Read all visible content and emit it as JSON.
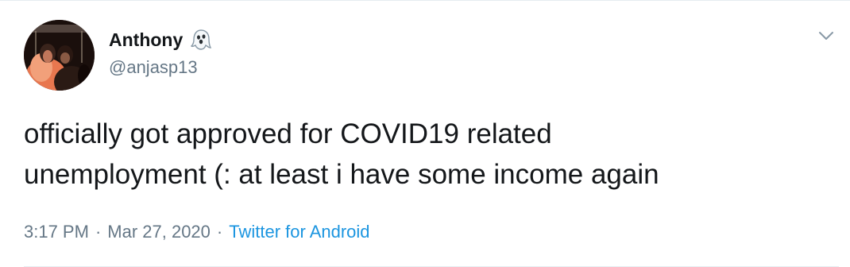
{
  "tweet": {
    "author": {
      "display_name": "Anthony",
      "name_emoji": "ghost-icon",
      "handle": "@anjasp13",
      "avatar": "avatar"
    },
    "menu_icon": "chevron-down-icon",
    "text_lines": [
      "officially got approved for COVID19 related",
      "unemployment (: at least i have some income again"
    ],
    "time": "3:17 PM",
    "separator": "·",
    "date": "Mar 27, 2020",
    "source": "Twitter for Android"
  },
  "colors": {
    "text": "#14171a",
    "secondary": "#657786",
    "link": "#1b95e0",
    "border": "#e6ecf0"
  }
}
